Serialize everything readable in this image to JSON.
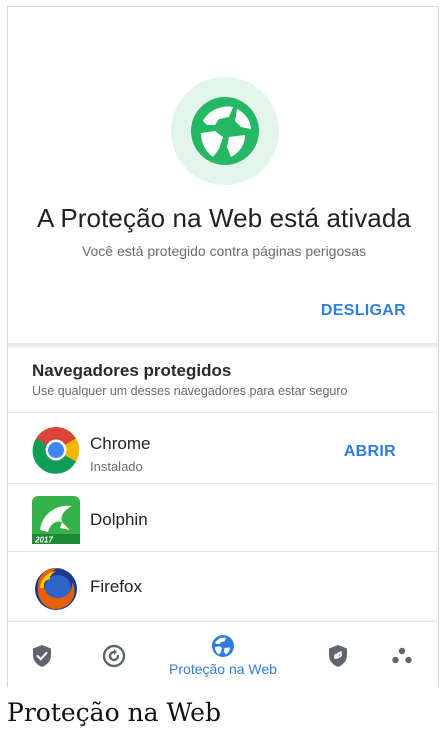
{
  "hero": {
    "icon": "globe-shield-icon",
    "title": "A Proteção na Web está ativada",
    "subtitle": "Você está protegido contra páginas perigosas",
    "disable_label": "DESLIGAR"
  },
  "browsers_section": {
    "title": "Navegadores protegidos",
    "subtitle": "Use qualquer um desses navegadores para estar seguro",
    "items": [
      {
        "name": "Chrome",
        "status": "Instalado",
        "action": "ABRIR",
        "icon": "chrome-icon"
      },
      {
        "name": "Dolphin",
        "status": "",
        "action": "",
        "icon": "dolphin-icon",
        "badge": "2017"
      },
      {
        "name": "Firefox",
        "status": "",
        "action": "",
        "icon": "firefox-icon"
      }
    ]
  },
  "bottom_nav": {
    "items": [
      {
        "icon": "shield-check-icon",
        "label": "",
        "active": false
      },
      {
        "icon": "refresh-scan-icon",
        "label": "",
        "active": false
      },
      {
        "icon": "web-protection-icon",
        "label": "Proteção na Web",
        "active": true
      },
      {
        "icon": "shield-link-icon",
        "label": "",
        "active": false
      },
      {
        "icon": "dots-cluster-icon",
        "label": "",
        "active": false
      }
    ]
  },
  "caption": "Proteção na Web",
  "colors": {
    "accent": "#2f7de1",
    "brand_green": "#25b864",
    "hero_bg": "#e3f5ea",
    "inactive_icon": "#5d6670"
  }
}
